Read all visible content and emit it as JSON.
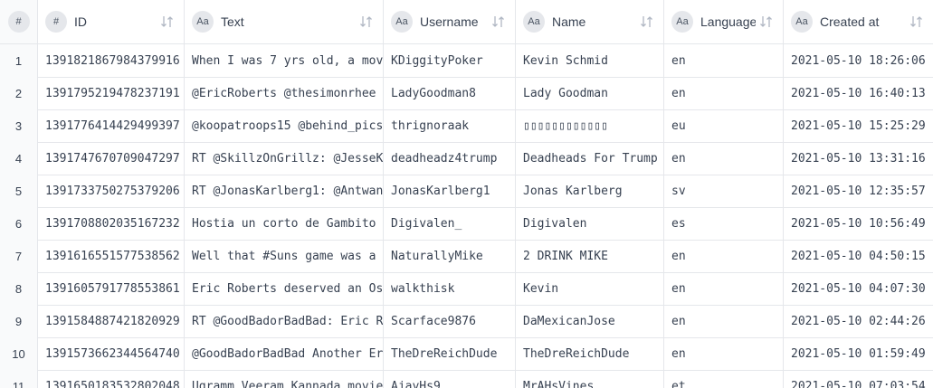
{
  "table": {
    "columns": [
      {
        "key": "idx",
        "label": "",
        "type_badge": "#",
        "sort_icon": "sort-icon"
      },
      {
        "key": "id",
        "label": "ID",
        "type_badge": "#",
        "sort_icon": "sort-icon"
      },
      {
        "key": "text",
        "label": "Text",
        "type_badge": "Aa",
        "sort_icon": "sort-icon"
      },
      {
        "key": "username",
        "label": "Username",
        "type_badge": "Aa",
        "sort_icon": "sort-icon"
      },
      {
        "key": "name",
        "label": "Name",
        "type_badge": "Aa",
        "sort_icon": "sort-icon"
      },
      {
        "key": "language",
        "label": "Language",
        "type_badge": "Aa",
        "sort_icon": "sort-icon"
      },
      {
        "key": "created_at",
        "label": "Created at",
        "type_badge": "Aa",
        "sort_icon": "sort-icon"
      }
    ],
    "rows": [
      {
        "n": "1",
        "id": "1391821867984379916",
        "text": "When I was 7 yrs old, a mov",
        "username": "KDiggityPoker",
        "name": "Kevin Schmid",
        "language": "en",
        "created_at": "2021-05-10 18:26:06"
      },
      {
        "n": "2",
        "id": "1391795219478237191",
        "text": "@EricRoberts @thesimonrhee",
        "username": "LadyGoodman8",
        "name": "Lady Goodman",
        "language": "en",
        "created_at": "2021-05-10 16:40:13"
      },
      {
        "n": "3",
        "id": "1391776414429499397",
        "text": "@koopatroops15 @behind_pics",
        "username": "thrignoraak",
        "name": "▯▯▯▯▯▯▯▯▯▯▯▯",
        "language": "eu",
        "created_at": "2021-05-10 15:25:29"
      },
      {
        "n": "4",
        "id": "1391747670709047297",
        "text": "RT @SkillzOnGrillz: @JesseK",
        "username": "deadheadz4trump",
        "name": "Deadheads For Trump",
        "language": "en",
        "created_at": "2021-05-10 13:31:16"
      },
      {
        "n": "5",
        "id": "1391733750275379206",
        "text": "RT @JonasKarlberg1: @Antwan",
        "username": "JonasKarlberg1",
        "name": "Jonas Karlberg",
        "language": "sv",
        "created_at": "2021-05-10 12:35:57"
      },
      {
        "n": "6",
        "id": "1391708802035167232",
        "text": "Hostia un corto de Gambito",
        "username": "Digivalen_",
        "name": "Digivalen",
        "language": "es",
        "created_at": "2021-05-10 10:56:49"
      },
      {
        "n": "7",
        "id": "1391616551577538562",
        "text": "Well that #Suns game was a",
        "username": "NaturallyMike",
        "name": "2 DRINK MIKE",
        "language": "en",
        "created_at": "2021-05-10 04:50:15"
      },
      {
        "n": "8",
        "id": "1391605791778553861",
        "text": "Eric Roberts deserved an Os",
        "username": "walkthisk",
        "name": "Kevin",
        "language": "en",
        "created_at": "2021-05-10 04:07:30"
      },
      {
        "n": "9",
        "id": "1391584887421820929",
        "text": "RT @GoodBadorBadBad: Eric R",
        "username": "Scarface9876",
        "name": "DaMexicanJose",
        "language": "en",
        "created_at": "2021-05-10 02:44:26"
      },
      {
        "n": "10",
        "id": "1391573662344564740",
        "text": "@GoodBadorBadBad Another Er",
        "username": "TheDreReichDude",
        "name": "TheDreReichDude",
        "language": "en",
        "created_at": "2021-05-10 01:59:49"
      },
      {
        "n": "11",
        "id": "1391650183532802048",
        "text": "Ugramm Veeram Kannada movie",
        "username": "AjayHs9",
        "name": "MrAHsVines",
        "language": "et",
        "created_at": "2021-05-10 07:03:54"
      }
    ]
  }
}
